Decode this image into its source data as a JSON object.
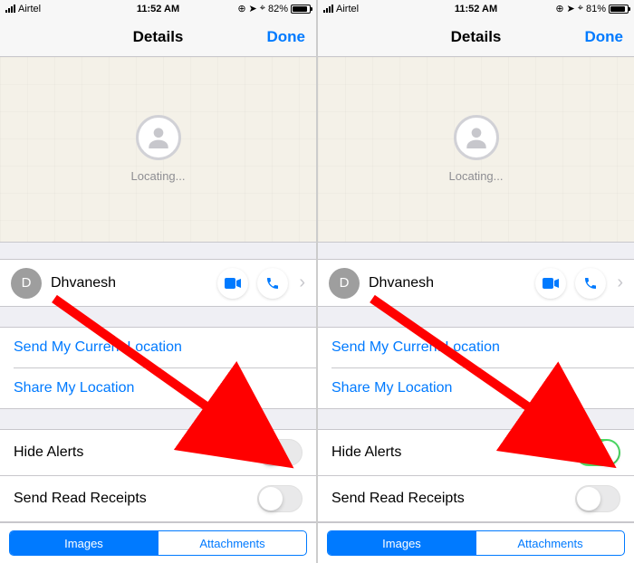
{
  "screens": [
    {
      "status": {
        "carrier": "Airtel",
        "time": "11:52 AM",
        "battery_pct": "82%",
        "battery_fill_pct": 82
      },
      "nav": {
        "title": "Details",
        "done": "Done"
      },
      "map": {
        "status": "Locating..."
      },
      "contact": {
        "initial": "D",
        "name": "Dhvanesh"
      },
      "links": {
        "send_location": "Send My Current Location",
        "share_location": "Share My Location"
      },
      "toggles": {
        "hide_alerts_label": "Hide Alerts",
        "hide_alerts_on": false,
        "read_receipts_label": "Send Read Receipts",
        "read_receipts_on": false
      },
      "tabs": {
        "images": "Images",
        "attachments": "Attachments",
        "active": "images"
      }
    },
    {
      "status": {
        "carrier": "Airtel",
        "time": "11:52 AM",
        "battery_pct": "81%",
        "battery_fill_pct": 81
      },
      "nav": {
        "title": "Details",
        "done": "Done"
      },
      "map": {
        "status": "Locating..."
      },
      "contact": {
        "initial": "D",
        "name": "Dhvanesh"
      },
      "links": {
        "send_location": "Send My Current Location",
        "share_location": "Share My Location"
      },
      "toggles": {
        "hide_alerts_label": "Hide Alerts",
        "hide_alerts_on": true,
        "read_receipts_label": "Send Read Receipts",
        "read_receipts_on": false
      },
      "tabs": {
        "images": "Images",
        "attachments": "Attachments",
        "active": "images"
      }
    }
  ],
  "colors": {
    "accent": "#007aff",
    "toggle_on": "#4cd964",
    "annotation": "#ff0000"
  }
}
